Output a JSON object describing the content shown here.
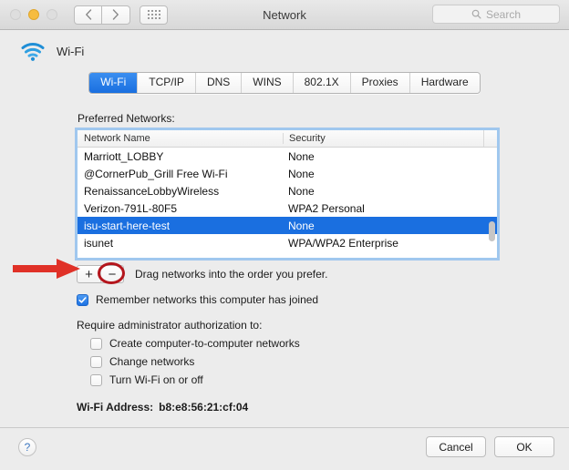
{
  "window": {
    "title": "Network",
    "traffic_lights": [
      "close",
      "minimize",
      "zoom"
    ]
  },
  "toolbar": {
    "back_icon": "chevron-left-icon",
    "forward_icon": "chevron-right-icon",
    "grid_icon": "show-all-icon",
    "search_placeholder": "Search",
    "search_value": "",
    "search_icon": "search-icon"
  },
  "service": {
    "icon": "wifi-icon",
    "name": "Wi-Fi"
  },
  "tabs": [
    {
      "label": "Wi-Fi",
      "active": true
    },
    {
      "label": "TCP/IP",
      "active": false
    },
    {
      "label": "DNS",
      "active": false
    },
    {
      "label": "WINS",
      "active": false
    },
    {
      "label": "802.1X",
      "active": false
    },
    {
      "label": "Proxies",
      "active": false
    },
    {
      "label": "Hardware",
      "active": false
    }
  ],
  "preferred_networks": {
    "label": "Preferred Networks:",
    "columns": [
      "Network Name",
      "Security"
    ],
    "rows": [
      {
        "name": "Marriott_LOBBY",
        "security": "None",
        "selected": false
      },
      {
        "name": "@CornerPub_Grill Free Wi-Fi",
        "security": "None",
        "selected": false
      },
      {
        "name": "RenaissanceLobbyWireless",
        "security": "None",
        "selected": false
      },
      {
        "name": "Verizon-791L-80F5",
        "security": "WPA2 Personal",
        "selected": false
      },
      {
        "name": "isu-start-here-test",
        "security": "None",
        "selected": true
      },
      {
        "name": "isunet",
        "security": "WPA/WPA2 Enterprise",
        "selected": false
      }
    ]
  },
  "list_controls": {
    "add_label": "+",
    "remove_label": "−",
    "hint": "Drag networks into the order you prefer."
  },
  "remember_networks": {
    "label": "Remember networks this computer has joined",
    "checked": true
  },
  "admin_section": {
    "label": "Require administrator authorization to:",
    "options": [
      {
        "label": "Create computer-to-computer networks",
        "checked": false
      },
      {
        "label": "Change networks",
        "checked": false
      },
      {
        "label": "Turn Wi-Fi on or off",
        "checked": false
      }
    ]
  },
  "wifi_address": {
    "label": "Wi-Fi Address:",
    "value": "b8:e8:56:21:cf:04"
  },
  "footer": {
    "help_label": "?",
    "cancel_label": "Cancel",
    "ok_label": "OK"
  },
  "annotations": {
    "arrow": {
      "target": "isu-start-here-test",
      "color": "#e03127"
    },
    "ellipse": {
      "target": "remove-network-button",
      "color": "#b4151c"
    }
  },
  "colors": {
    "accent_blue": "#1a6fe0",
    "selection_blue": "#1a6fe0",
    "annotation_red": "#e03127",
    "annotation_dark_red": "#b4151c",
    "wifi_icon_blue": "#1f8ed6"
  }
}
